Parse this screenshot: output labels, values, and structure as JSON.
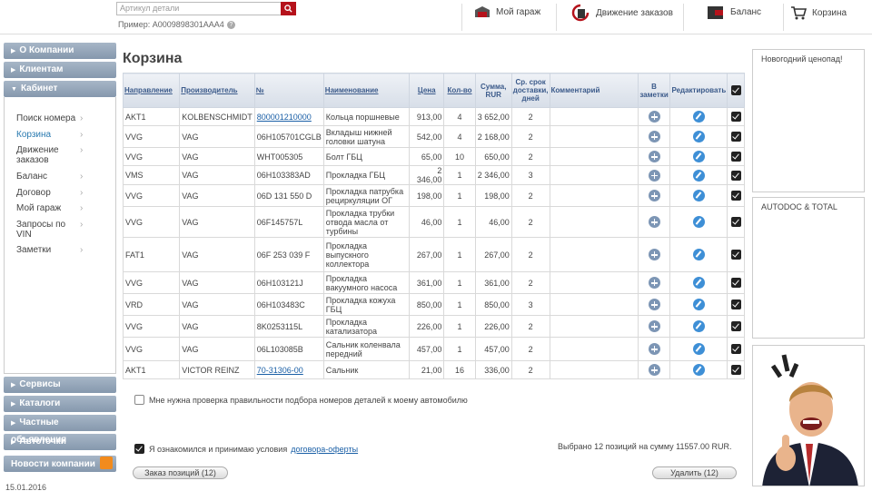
{
  "header": {
    "search_placeholder": "Артикул детали",
    "example_label": "Пример: A0009898301AAA4",
    "help_label": "?",
    "nav": {
      "garage": "Мой гараж",
      "orders": "Движение заказов",
      "balance": "Баланс",
      "cart": "Корзина"
    }
  },
  "sidebar": {
    "top": [
      "О Компании",
      "Клиентам"
    ],
    "cabinet": "Кабинет",
    "items": [
      "Поиск номера",
      "Корзина",
      "Движение заказов",
      "Баланс",
      "Договор",
      "Мой гараж",
      "Запросы по VIN",
      "Заметки"
    ],
    "active_index": 1,
    "bottom": [
      "Сервисы",
      "Каталоги",
      "Частные объявления",
      "Автоточки"
    ],
    "news": "Новости компании",
    "date": "15.01.2016"
  },
  "main": {
    "title": "Корзина",
    "columns": {
      "direction": "Направление",
      "maker": "Производитель",
      "num": "№",
      "name": "Наименование",
      "price": "Цена",
      "qty": "Кол-во",
      "sum": "Сумма, RUR",
      "term": "Ср. срок доставки, дней",
      "comment": "Комментарий",
      "notes": "В заметки",
      "edit": "Редактировать"
    },
    "rows": [
      {
        "dir": "AKT1",
        "maker": "KOLBENSCHMIDT",
        "num": "800001210000",
        "link": true,
        "name": "Кольца поршневые",
        "price": "913,00",
        "qty": "4",
        "sum": "3 652,00",
        "term": "2"
      },
      {
        "dir": "VVG",
        "maker": "VAG",
        "num": "06H105701CGLB",
        "link": false,
        "name": "Вкладыш нижней головки шатуна",
        "price": "542,00",
        "qty": "4",
        "sum": "2 168,00",
        "term": "2"
      },
      {
        "dir": "VVG",
        "maker": "VAG",
        "num": "WHT005305",
        "link": false,
        "name": "Болт ГБЦ",
        "price": "65,00",
        "qty": "10",
        "sum": "650,00",
        "term": "2"
      },
      {
        "dir": "VMS",
        "maker": "VAG",
        "num": "06H103383AD",
        "link": false,
        "name": "Прокладка ГБЦ",
        "price": "2 346,00",
        "qty": "1",
        "sum": "2 346,00",
        "term": "3"
      },
      {
        "dir": "VVG",
        "maker": "VAG",
        "num": "06D 131 550 D",
        "link": false,
        "name": "Прокладка патрубка рециркуляции ОГ",
        "price": "198,00",
        "qty": "1",
        "sum": "198,00",
        "term": "2"
      },
      {
        "dir": "VVG",
        "maker": "VAG",
        "num": "06F145757L",
        "link": false,
        "name": "Прокладка трубки отвода масла от турбины",
        "price": "46,00",
        "qty": "1",
        "sum": "46,00",
        "term": "2"
      },
      {
        "dir": "FAT1",
        "maker": "VAG",
        "num": "06F 253 039 F",
        "link": false,
        "name": "Прокладка выпускного коллектора",
        "price": "267,00",
        "qty": "1",
        "sum": "267,00",
        "term": "2"
      },
      {
        "dir": "VVG",
        "maker": "VAG",
        "num": "06H103121J",
        "link": false,
        "name": "Прокладка вакуумного насоса",
        "price": "361,00",
        "qty": "1",
        "sum": "361,00",
        "term": "2"
      },
      {
        "dir": "VRD",
        "maker": "VAG",
        "num": "06H103483C",
        "link": false,
        "name": "Прокладка кожуха ГБЦ",
        "price": "850,00",
        "qty": "1",
        "sum": "850,00",
        "term": "3"
      },
      {
        "dir": "VVG",
        "maker": "VAG",
        "num": "8K0253115L",
        "link": false,
        "name": "Прокладка катализатора",
        "price": "226,00",
        "qty": "1",
        "sum": "226,00",
        "term": "2"
      },
      {
        "dir": "VVG",
        "maker": "VAG",
        "num": "06L103085B",
        "link": false,
        "name": "Сальник коленвала передний",
        "price": "457,00",
        "qty": "1",
        "sum": "457,00",
        "term": "2"
      },
      {
        "dir": "AKT1",
        "maker": "VICTOR REINZ",
        "num": "70-31306-00",
        "link": true,
        "name": "Сальник",
        "price": "21,00",
        "qty": "16",
        "sum": "336,00",
        "term": "2"
      }
    ],
    "check_verify": "Мне нужна проверка правильности подбора номеров деталей к моему автомобилю",
    "agree_prefix": "Я ознакомился и принимаю условия",
    "agree_link": "договора-оферты",
    "summary": "Выбрано 12 позиций на сумму 11557.00 RUR.",
    "order_button": "Заказ позиций (12)",
    "delete_button": "Удалить (12)"
  },
  "right": {
    "box1": "Новогодний ценопад!",
    "box2": "AUTODOC & TOTAL"
  },
  "colors": {
    "accent": "#b5121b",
    "header_blue": "#3b5a8a",
    "side_btn": "#8598ad"
  }
}
